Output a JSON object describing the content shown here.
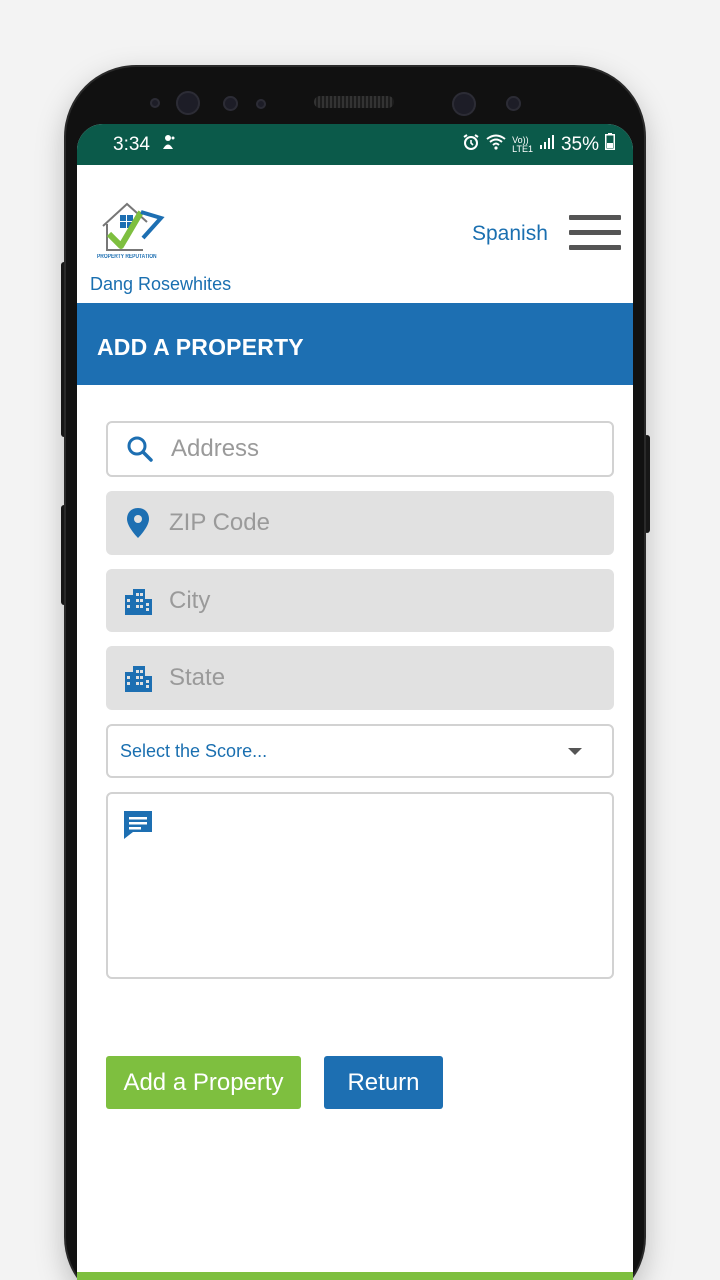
{
  "status_bar": {
    "time": "3:34",
    "network_label_top": "Vo))",
    "network_label_bottom": "LTE1",
    "battery_percent": "35%"
  },
  "header": {
    "logo_text": "PROPERTY REPUTATION",
    "user_name": "Dang Rosewhites",
    "language_link": "Spanish"
  },
  "page": {
    "title": "ADD A PROPERTY"
  },
  "form": {
    "address_placeholder": "Address",
    "zip_placeholder": "ZIP Code",
    "city_placeholder": "City",
    "state_placeholder": "State",
    "score_select_value": "Select the Score...",
    "comment_value": ""
  },
  "buttons": {
    "add_property": "Add a Property",
    "return": "Return"
  },
  "colors": {
    "brand_blue": "#1d6fb2",
    "brand_green": "#7ebf3f",
    "status_bar": "#0b5a4a",
    "field_disabled": "#e1e1e1"
  }
}
